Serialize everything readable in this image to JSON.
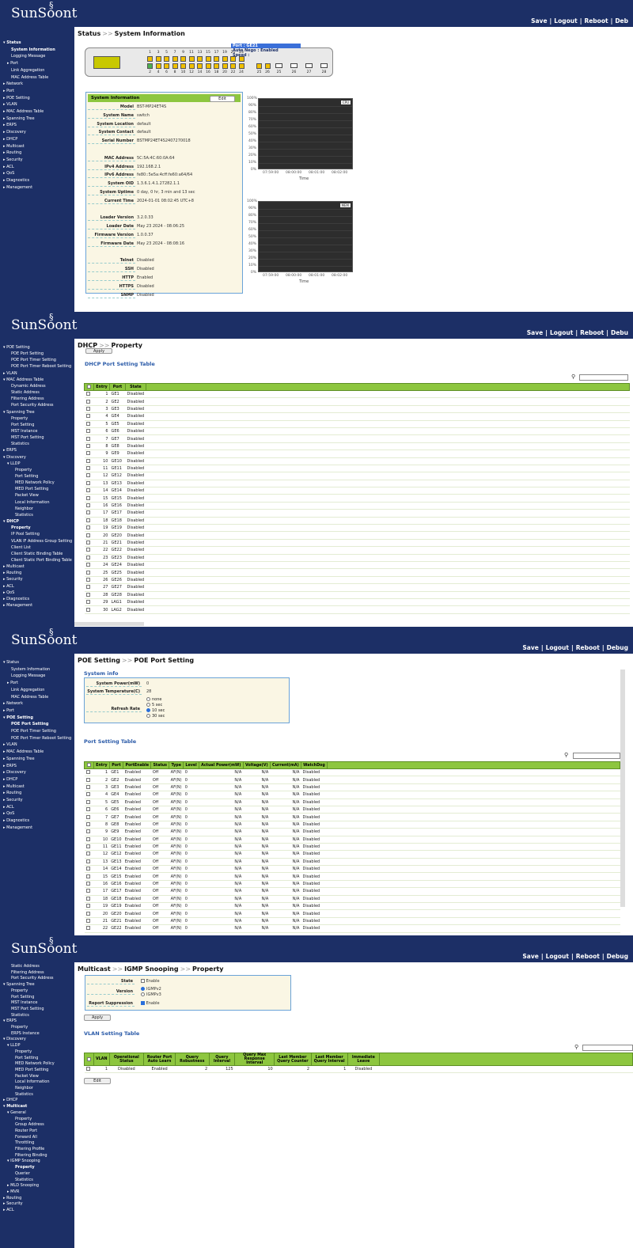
{
  "header": {
    "logo": "SunSoont",
    "logo_mark": "§",
    "links": [
      "Save",
      "|",
      "Logout",
      "|",
      "Reboot",
      "|",
      "Deb"
    ],
    "links2": [
      "Save",
      "|",
      "Logout",
      "|",
      "Reboot",
      "|",
      "Debu"
    ],
    "links3": [
      "Save",
      "|",
      "Logout",
      "|",
      "Reboot",
      "|",
      "Debug"
    ],
    "links4": [
      "Save",
      "|",
      "Logout",
      "|",
      "Reboot",
      "|",
      "Debug"
    ]
  },
  "s1": {
    "title": [
      "Status",
      "System Information"
    ],
    "sidebar": [
      {
        "t": "▾ Status",
        "b": true
      },
      {
        "t": "System Information",
        "b": true,
        "i": 2
      },
      {
        "t": "Logging Message",
        "i": 2
      },
      {
        "t": "▸ Port",
        "i": 1
      },
      {
        "t": "Link Aggregation",
        "i": 2
      },
      {
        "t": "MAC Address Table",
        "i": 2
      },
      {
        "t": "▸ Network"
      },
      {
        "t": "▸ Port"
      },
      {
        "t": "▸ POE Setting"
      },
      {
        "t": "▸ VLAN"
      },
      {
        "t": "▸ MAC Address Table"
      },
      {
        "t": "▸ Spanning Tree"
      },
      {
        "t": "▸ ERPS"
      },
      {
        "t": "▸ Discovery"
      },
      {
        "t": "▸ DHCP"
      },
      {
        "t": "▸ Multicast"
      },
      {
        "t": "▸ Routing"
      },
      {
        "t": "▸ Security"
      },
      {
        "t": "▸ ACL"
      },
      {
        "t": "▸ QoS"
      },
      {
        "t": "▸ Diagnostics"
      },
      {
        "t": "▸ Management"
      }
    ],
    "tooltip": [
      "Port : GE21",
      "Auto Nego : Enabled",
      "Speed :"
    ],
    "ports_top": [
      "1",
      "3",
      "5",
      "7",
      "9",
      "11",
      "13",
      "15",
      "17",
      "19",
      "21",
      "23"
    ],
    "ports_bottom": [
      "2",
      "4",
      "6",
      "8",
      "10",
      "12",
      "14",
      "16",
      "18",
      "20",
      "22",
      "24"
    ],
    "combo_top": [
      "25",
      "26"
    ],
    "sfp": [
      "25",
      "26",
      "27",
      "28"
    ],
    "info_head": "System Information",
    "edit": "Edit",
    "rows": [
      [
        "Model",
        "BST-MP24ET4S"
      ],
      [
        "System Name",
        "switch"
      ],
      [
        "System Location",
        "default"
      ],
      [
        "System Contact",
        "default"
      ],
      [
        "Serial Number",
        "BSTMP24ET4S2407270018"
      ],
      [
        "",
        ""
      ],
      [
        "MAC Address",
        "5C:5A:4C:60:0A:64"
      ],
      [
        "IPv4 Address",
        "192.168.2.1"
      ],
      [
        "IPv6 Address",
        "fe80::5e5a:4cff:fe60:a64/64"
      ],
      [
        "System OID",
        "1.3.6.1.4.1.27282.1.1"
      ],
      [
        "System Uptime",
        "0 day, 0 hr, 3 min and 13 sec"
      ],
      [
        "Current Time",
        "2024-01-01 08:02:45 UTC+8"
      ],
      [
        "",
        ""
      ],
      [
        "Loader Version",
        "3.2.0.33"
      ],
      [
        "Loader Date",
        "May 23 2024 - 08:06:25"
      ],
      [
        "Firmware Version",
        "1.0.0.37"
      ],
      [
        "Firmware Date",
        "May 23 2024 - 08:08:16"
      ],
      [
        "",
        ""
      ],
      [
        "Telnet",
        "Disabled"
      ],
      [
        "SSH",
        "Disabled"
      ],
      [
        "HTTP",
        "Enabled"
      ],
      [
        "HTTPS",
        "Disabled"
      ],
      [
        "SNMP",
        "Disabled"
      ]
    ],
    "graph_y": [
      "100%",
      "90%",
      "80%",
      "70%",
      "60%",
      "50%",
      "40%",
      "30%",
      "20%",
      "10%",
      "0%"
    ],
    "graph1_x": [
      "07:59:00",
      "08:00:00",
      "08:01:00",
      "08:02:00"
    ],
    "graph2_x": [
      "07:59:00",
      "08:00:00",
      "08:01:00",
      "08:02:00"
    ],
    "graph_xlabel": "Time",
    "legend1": "CPU",
    "legend2": "MEM"
  },
  "s2": {
    "title": [
      "DHCP",
      "Property"
    ],
    "apply": "Apply",
    "table_title": "DHCP Port Setting Table",
    "sidebar": [
      {
        "t": "▾ POE Setting",
        "i": 0
      },
      {
        "t": "POE Port Setting",
        "i": 2
      },
      {
        "t": "POE Port Timer Setting",
        "i": 2
      },
      {
        "t": "POE Port Timer Reboot Setting",
        "i": 2
      },
      {
        "t": "▸ VLAN"
      },
      {
        "t": "▾ MAC Address Table"
      },
      {
        "t": "Dynamic Address",
        "i": 2
      },
      {
        "t": "Static Address",
        "i": 2
      },
      {
        "t": "Filtering Address",
        "i": 2
      },
      {
        "t": "Port Security Address",
        "i": 2
      },
      {
        "t": "▾ Spanning Tree"
      },
      {
        "t": "Property",
        "i": 2
      },
      {
        "t": "Port Setting",
        "i": 2
      },
      {
        "t": "MST Instance",
        "i": 2
      },
      {
        "t": "MST Port Setting",
        "i": 2
      },
      {
        "t": "Statistics",
        "i": 2
      },
      {
        "t": "▸ ERPS"
      },
      {
        "t": "▾ Discovery"
      },
      {
        "t": "▾ LLDP",
        "i": 1
      },
      {
        "t": "Property",
        "i": 3
      },
      {
        "t": "Port Setting",
        "i": 3
      },
      {
        "t": "MED Network Policy",
        "i": 3
      },
      {
        "t": "MED Port Setting",
        "i": 3
      },
      {
        "t": "Packet View",
        "i": 3
      },
      {
        "t": "Local Information",
        "i": 3
      },
      {
        "t": "Neighbor",
        "i": 3
      },
      {
        "t": "Statistics",
        "i": 3
      },
      {
        "t": "▾ DHCP",
        "b": true
      },
      {
        "t": "Property",
        "b": true,
        "i": 2
      },
      {
        "t": "IP Pool Setting",
        "i": 2
      },
      {
        "t": "VLAN IF Address Group Setting",
        "i": 2
      },
      {
        "t": "Client List",
        "i": 2
      },
      {
        "t": "Client Static Binding Table",
        "i": 2
      },
      {
        "t": "Client Static Port Binding Table",
        "i": 2
      },
      {
        "t": "▸ Multicast"
      },
      {
        "t": "▸ Routing"
      },
      {
        "t": "▸ Security"
      },
      {
        "t": "▸ ACL"
      },
      {
        "t": "▸ QoS"
      },
      {
        "t": "▸ Diagnostics"
      },
      {
        "t": "▸ Management"
      }
    ],
    "headers": [
      "Entry",
      "Port",
      "State"
    ],
    "rows": [
      [
        "1",
        "GE1",
        "Disabled"
      ],
      [
        "2",
        "GE2",
        "Disabled"
      ],
      [
        "3",
        "GE3",
        "Disabled"
      ],
      [
        "4",
        "GE4",
        "Disabled"
      ],
      [
        "5",
        "GE5",
        "Disabled"
      ],
      [
        "6",
        "GE6",
        "Disabled"
      ],
      [
        "7",
        "GE7",
        "Disabled"
      ],
      [
        "8",
        "GE8",
        "Disabled"
      ],
      [
        "9",
        "GE9",
        "Disabled"
      ],
      [
        "10",
        "GE10",
        "Disabled"
      ],
      [
        "11",
        "GE11",
        "Disabled"
      ],
      [
        "12",
        "GE12",
        "Disabled"
      ],
      [
        "13",
        "GE13",
        "Disabled"
      ],
      [
        "14",
        "GE14",
        "Disabled"
      ],
      [
        "15",
        "GE15",
        "Disabled"
      ],
      [
        "16",
        "GE16",
        "Disabled"
      ],
      [
        "17",
        "GE17",
        "Disabled"
      ],
      [
        "18",
        "GE18",
        "Disabled"
      ],
      [
        "19",
        "GE19",
        "Disabled"
      ],
      [
        "20",
        "GE20",
        "Disabled"
      ],
      [
        "21",
        "GE21",
        "Disabled"
      ],
      [
        "22",
        "GE22",
        "Disabled"
      ],
      [
        "23",
        "GE23",
        "Disabled"
      ],
      [
        "24",
        "GE24",
        "Disabled"
      ],
      [
        "25",
        "GE25",
        "Disabled"
      ],
      [
        "26",
        "GE26",
        "Disabled"
      ],
      [
        "27",
        "GE27",
        "Disabled"
      ],
      [
        "28",
        "GE28",
        "Disabled"
      ],
      [
        "29",
        "LAG1",
        "Disabled"
      ],
      [
        "30",
        "LAG2",
        "Disabled"
      ]
    ]
  },
  "s3": {
    "title": [
      "POE Setting",
      "POE Port Setting"
    ],
    "sys_title": "System info",
    "sidebar": [
      {
        "t": "▾ Status"
      },
      {
        "t": "System Information",
        "i": 2
      },
      {
        "t": "Logging Message",
        "i": 2
      },
      {
        "t": "▸ Port",
        "i": 1
      },
      {
        "t": "Link Aggregation",
        "i": 2
      },
      {
        "t": "MAC Address Table",
        "i": 2
      },
      {
        "t": "▸ Network"
      },
      {
        "t": "▸ Port"
      },
      {
        "t": "▾ POE Setting",
        "b": true
      },
      {
        "t": "POE Port Setting",
        "b": true,
        "i": 2
      },
      {
        "t": "POE Port Timer Setting",
        "i": 2
      },
      {
        "t": "POE Port Timer Reboot Setting",
        "i": 2
      },
      {
        "t": "▸ VLAN"
      },
      {
        "t": "▸ MAC Address Table"
      },
      {
        "t": "▸ Spanning Tree"
      },
      {
        "t": "▸ ERPS"
      },
      {
        "t": "▸ Discovery"
      },
      {
        "t": "▸ DHCP"
      },
      {
        "t": "▸ Multicast"
      },
      {
        "t": "▸ Routing"
      },
      {
        "t": "▸ Security"
      },
      {
        "t": "▸ ACL"
      },
      {
        "t": "▸ QoS"
      },
      {
        "t": "▸ Diagnostics"
      },
      {
        "t": "▸ Management"
      }
    ],
    "power_label": "System Power(mW)",
    "power": "0",
    "temp_label": "System Temperature(C)",
    "temp": "28",
    "refresh_label": "Refresh Rate",
    "refresh_opts": [
      "none",
      "5 sec",
      "10 sec",
      "30 sec"
    ],
    "refresh_sel": 2,
    "table_title": "Port Setting Table",
    "headers": [
      "Entry",
      "Port",
      "PortEnable",
      "Status",
      "Type",
      "Level",
      "Actual Power(mW)",
      "Voltage(V)",
      "Current(mA)",
      "WatchDog"
    ],
    "rows": [
      [
        "1",
        "GE1"
      ],
      [
        "2",
        "GE2"
      ],
      [
        "3",
        "GE3"
      ],
      [
        "4",
        "GE4"
      ],
      [
        "5",
        "GE5"
      ],
      [
        "6",
        "GE6"
      ],
      [
        "7",
        "GE7"
      ],
      [
        "8",
        "GE8"
      ],
      [
        "9",
        "GE9"
      ],
      [
        "10",
        "GE10"
      ],
      [
        "11",
        "GE11"
      ],
      [
        "12",
        "GE12"
      ],
      [
        "13",
        "GE13"
      ],
      [
        "14",
        "GE14"
      ],
      [
        "15",
        "GE15"
      ],
      [
        "16",
        "GE16"
      ],
      [
        "17",
        "GE17"
      ],
      [
        "18",
        "GE18"
      ],
      [
        "19",
        "GE19"
      ],
      [
        "20",
        "GE20"
      ],
      [
        "21",
        "GE21"
      ],
      [
        "22",
        "GE22"
      ]
    ],
    "row_vals": [
      "Enabled",
      "Off",
      "AF(N)",
      "0",
      "N/A",
      "N/A",
      "N/A",
      "Disabled"
    ]
  },
  "s4": {
    "title": [
      "Multicast",
      "IGMP Snooping",
      "Property"
    ],
    "sidebar": [
      {
        "t": "Static Address",
        "i": 2
      },
      {
        "t": "Filtering Address",
        "i": 2
      },
      {
        "t": "Port Security Address",
        "i": 2
      },
      {
        "t": "▾ Spanning Tree"
      },
      {
        "t": "Property",
        "i": 2
      },
      {
        "t": "Port Setting",
        "i": 2
      },
      {
        "t": "MST Instance",
        "i": 2
      },
      {
        "t": "MST Port Setting",
        "i": 2
      },
      {
        "t": "Statistics",
        "i": 2
      },
      {
        "t": "▾ ERPS"
      },
      {
        "t": "Property",
        "i": 2
      },
      {
        "t": "ERPS Instance",
        "i": 2
      },
      {
        "t": "▾ Discovery"
      },
      {
        "t": "▾ LLDP",
        "i": 1
      },
      {
        "t": "Property",
        "i": 3
      },
      {
        "t": "Port Setting",
        "i": 3
      },
      {
        "t": "MED Network Policy",
        "i": 3
      },
      {
        "t": "MED Port Setting",
        "i": 3
      },
      {
        "t": "Packet View",
        "i": 3
      },
      {
        "t": "Local Information",
        "i": 3
      },
      {
        "t": "Neighbor",
        "i": 3
      },
      {
        "t": "Statistics",
        "i": 3
      },
      {
        "t": "▸ DHCP"
      },
      {
        "t": "▾ Multicast",
        "b": true
      },
      {
        "t": "▾ General",
        "i": 1
      },
      {
        "t": "Property",
        "i": 3
      },
      {
        "t": "Group Address",
        "i": 3
      },
      {
        "t": "Router Port",
        "i": 3
      },
      {
        "t": "Forward All",
        "i": 3
      },
      {
        "t": "Throttling",
        "i": 3
      },
      {
        "t": "Filtering Profile",
        "i": 3
      },
      {
        "t": "Filtering Binding",
        "i": 3
      },
      {
        "t": "▾ IGMP Snooping",
        "i": 1
      },
      {
        "t": "Property",
        "b": true,
        "i": 3
      },
      {
        "t": "Querier",
        "i": 3
      },
      {
        "t": "Statistics",
        "i": 3
      },
      {
        "t": "▸ MLD Snooping",
        "i": 1
      },
      {
        "t": "▸ MVR",
        "i": 1
      },
      {
        "t": "▸ Routing"
      },
      {
        "t": "▸ Security"
      },
      {
        "t": "▸ ACL"
      }
    ],
    "state_label": "State",
    "state_opt": "Enable",
    "version_label": "Version",
    "versions": [
      "IGMPv2",
      "IGMPv3"
    ],
    "report_label": "Report Suppression",
    "report_opt": "Enable",
    "apply": "Apply",
    "table_title": "VLAN Setting Table",
    "headers": [
      "VLAN",
      "Operational Status",
      "Router Port Auto Learn",
      "Query Robustness",
      "Query Interval",
      "Query Max Response Interval",
      "Last Member Query Counter",
      "Last Member Query Interval",
      "Immediate Leave"
    ],
    "rows": [
      [
        "1",
        "Disabled",
        "Enabled",
        "2",
        "125",
        "10",
        "2",
        "1",
        "Disabled"
      ]
    ],
    "edit": "Edit"
  }
}
